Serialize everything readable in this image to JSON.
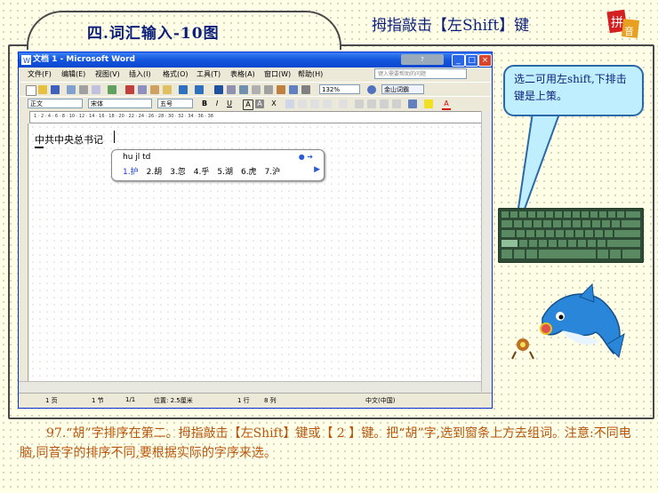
{
  "slide": {
    "title": "四.词汇输入-10图",
    "subtitle": "拇指敲击【左Shift】键",
    "logo_text": "拼音",
    "callout": "选二可用左shift,下排击键是上策。",
    "caption": "97.“胡”字排序在第二。拇指敲击【左Shift】键或【 2 】键。把“胡”字,选到窗条上方去组词。注意:不同电脑,同音字的排序不同,要根据实际的字序来选。"
  },
  "word": {
    "title": "文档 1 - Microsoft Word",
    "menu": [
      "文件(F)",
      "编辑(E)",
      "视图(V)",
      "插入(I)",
      "格式(O)",
      "工具(T)",
      "表格(A)",
      "窗口(W)",
      "帮助(H)"
    ],
    "ask_placeholder": "键入需要帮助的问题",
    "style": "正文",
    "font": "宋体",
    "size": "五号",
    "zoom": "132%",
    "kingsoft": "金山词霸",
    "doc_text": "中共中央总书记",
    "ruler_marks": "1 · 2 · 4 · 6 · 8 · 10 · 12 · 14 · 16 · 18 · 20 · 22 · 24 · 26 · 28 · 30 · 32 · 34 · 36 · 38",
    "status": {
      "page": "1 页",
      "section": "1 节",
      "pages": "1/1",
      "position": "位置: 2.5厘米",
      "line": "1 行",
      "col": "8 列",
      "lang": "中文(中国)"
    }
  },
  "ime": {
    "code": "hu jl td",
    "candidates": [
      "1.护",
      "2.胡",
      "3.忽",
      "4.乎",
      "5.湖",
      "6.虎",
      "7.沪"
    ]
  }
}
